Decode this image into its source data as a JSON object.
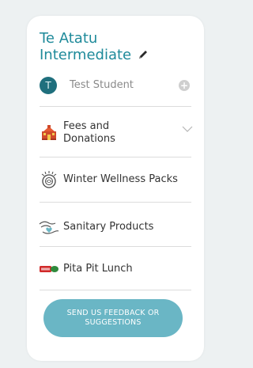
{
  "school": {
    "name": "Te Atatu Intermediate"
  },
  "student": {
    "initial": "T",
    "name": "Test Student",
    "add_symbol": "+"
  },
  "menu": {
    "items": [
      {
        "label": "Fees and Donations",
        "icon": "school-building-icon"
      },
      {
        "label": "Winter Wellness Packs",
        "icon": "wellness-pack-icon"
      },
      {
        "label": "Sanitary Products",
        "icon": "hands-heart-icon"
      },
      {
        "label": "Pita Pit Lunch",
        "icon": "pita-pit-logo-icon"
      }
    ]
  },
  "feedback": {
    "label": "SEND US FEEDBACK OR SUGGESTIONS"
  },
  "colors": {
    "accent": "#1e8a9a",
    "button": "#6ab6c5",
    "background": "#edf1f2"
  }
}
